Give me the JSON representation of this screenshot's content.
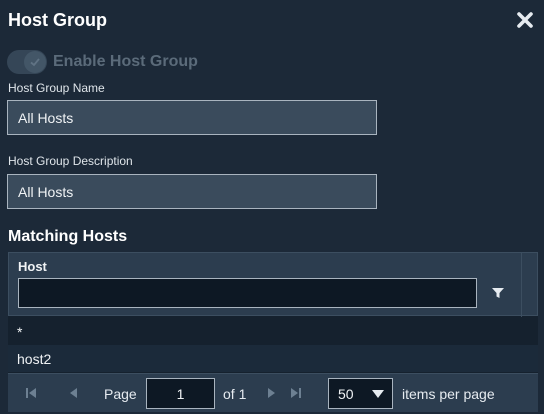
{
  "dialog": {
    "title": "Host Group",
    "close_icon": "close-icon"
  },
  "enable": {
    "label": "Enable Host Group",
    "checked": true,
    "disabled": true
  },
  "name_field": {
    "label": "Host Group Name",
    "value": "All Hosts"
  },
  "description_field": {
    "label": "Host Group Description",
    "value": "All Hosts"
  },
  "matching": {
    "title": "Matching Hosts",
    "column": "Host",
    "filter_value": "",
    "filter_icon": "filter-icon",
    "rows": [
      "*",
      "host2"
    ]
  },
  "pager": {
    "page_label": "Page",
    "current_page": "1",
    "of_label": "of 1",
    "page_size": "50",
    "items_per_page_label": "items per page"
  },
  "colors": {
    "background": "#1c2938",
    "header": "#2c3d4f",
    "input_bg": "#3a4b5c",
    "dark_input": "#0d1824",
    "text": "#e6ebf0"
  }
}
